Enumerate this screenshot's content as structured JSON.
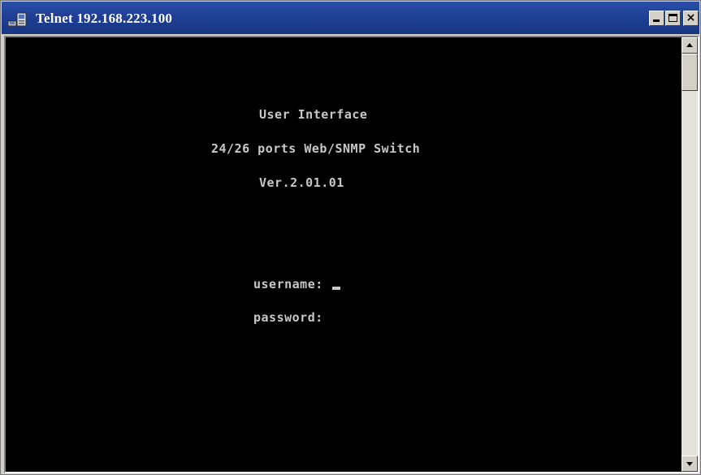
{
  "window": {
    "title": "Telnet 192.168.223.100",
    "icon": "telnet-computer-icon",
    "controls": {
      "minimize_icon": "minimize-icon",
      "maximize_icon": "maximize-icon",
      "close_glyph": "×"
    }
  },
  "terminal": {
    "background": "#000000",
    "foreground": "#c8c8c8",
    "lines": {
      "title": "User Interface",
      "model": "24/26 ports Web/SNMP Switch",
      "version": "Ver.2.01.01",
      "username_prompt": "username:",
      "password_prompt": "password:"
    },
    "cursor_field": "username"
  },
  "scrollbar": {
    "up_icon": "arrow-up-icon",
    "down_icon": "arrow-down-icon",
    "position": 0
  },
  "colors": {
    "titlebar": "#1f3f95",
    "chrome": "#d4d0c8"
  }
}
